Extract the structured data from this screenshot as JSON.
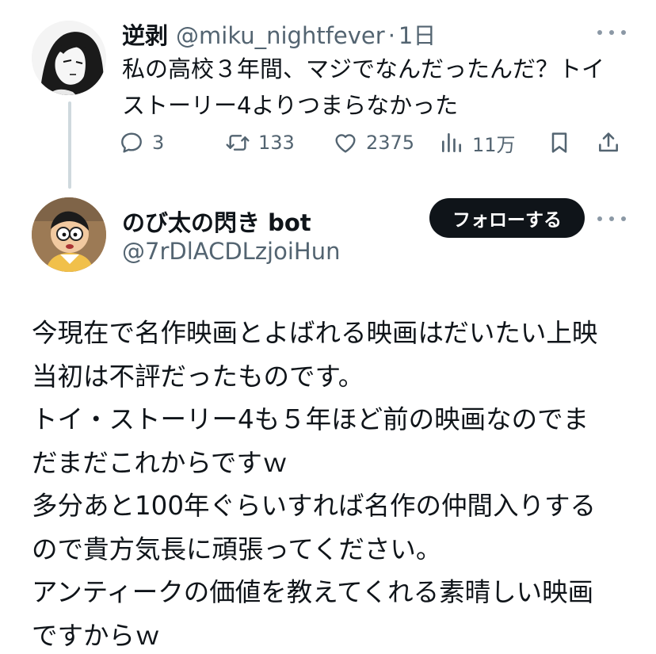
{
  "thread": {
    "tweet1": {
      "display_name": "逆剥",
      "handle": "@miku_nightfever",
      "separator": "·",
      "time": "1日",
      "text_lines": [
        "私の高校３年間、マジでなんだったんだ？トイ",
        "ストーリー4よりつまらなかった"
      ],
      "stats": {
        "replies": "3",
        "retweets": "133",
        "likes": "2375",
        "views": "11万"
      }
    },
    "tweet2": {
      "display_name": "のび太の閃き bot",
      "handle": "@7rDlACDLzjoiHun",
      "follow_label": "フォローする",
      "text_lines": [
        "今現在で名作映画とよばれる映画はだいたい上映",
        "当初は不評だったものです。",
        "トイ・ストーリー4も５年ほど前の映画なのでま",
        "だまだこれからですｗ",
        "多分あと100年ぐらいすれば名作の仲間入りする",
        "ので貴方気長に頑張ってください。",
        "アンティークの価値を教えてくれる素晴しい映画",
        "ですからｗ"
      ]
    }
  },
  "icons": {
    "more": "more-horizontal-icon",
    "reply": "reply-icon",
    "retweet": "retweet-icon",
    "like": "heart-icon",
    "views": "views-icon",
    "bookmark": "bookmark-icon",
    "share": "share-icon"
  },
  "colors": {
    "text": "#0f1419",
    "secondary": "#536471",
    "follow_button": "#0f1419",
    "thread_line": "#cfd9de"
  }
}
